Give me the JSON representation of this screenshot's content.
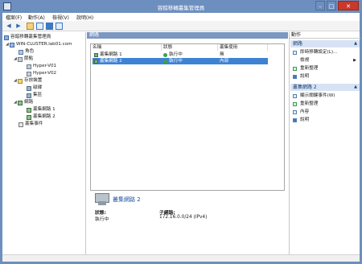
{
  "window": {
    "title": "容錯移轉叢集管理員",
    "min_glyph": "–",
    "max_glyph": "□",
    "close_glyph": "✕"
  },
  "menu": {
    "items": [
      "檔案(F)",
      "動作(A)",
      "檢視(V)",
      "說明(H)"
    ]
  },
  "toolbar": {
    "back_glyph": "◀",
    "forward_glyph": "▶"
  },
  "tree": {
    "root": "容錯移轉叢集管理員",
    "cluster": "WIN-CLUSTER.lab01.com",
    "roles": "角色",
    "nodes": "節點",
    "node1": "Hyper-V01",
    "node2": "Hyper-V02",
    "storage": "存放裝置",
    "disks": "磁碟",
    "pools": "集區",
    "networks": "網路",
    "net1": "叢集網路 1",
    "net2": "叢集網路 2",
    "events": "叢集事件"
  },
  "center": {
    "header": "網路",
    "columns": [
      "名稱",
      "狀態",
      "叢集使用"
    ],
    "rows": [
      {
        "name": "叢集網路 1",
        "status": "執行中",
        "use": "無"
      },
      {
        "name": "叢集網路 2",
        "status": "執行中",
        "use": "內部"
      }
    ],
    "detail": {
      "title": "叢集網路 2",
      "status_label": "狀態:",
      "status_value": "執行中",
      "subnet_label": "子網路:",
      "subnet_value": "172.16.0.0/24 (IPv4)"
    }
  },
  "actions": {
    "header": "動作",
    "section1": "網路",
    "section1_items": [
      "即時移轉設定(L)...",
      "檢視",
      "重新整理",
      "說明"
    ],
    "section2": "叢集網路 2",
    "section2_items": [
      "顯示關鍵事件(W)",
      "重新整理",
      "內容",
      "說明"
    ],
    "up_glyph": "▲",
    "submenu_glyph": "▶"
  },
  "colors": {
    "title_bar": "#6d8fbf",
    "selection": "#3e82d4",
    "section_header": "#d7e3f4",
    "close_button": "#c9392b"
  }
}
